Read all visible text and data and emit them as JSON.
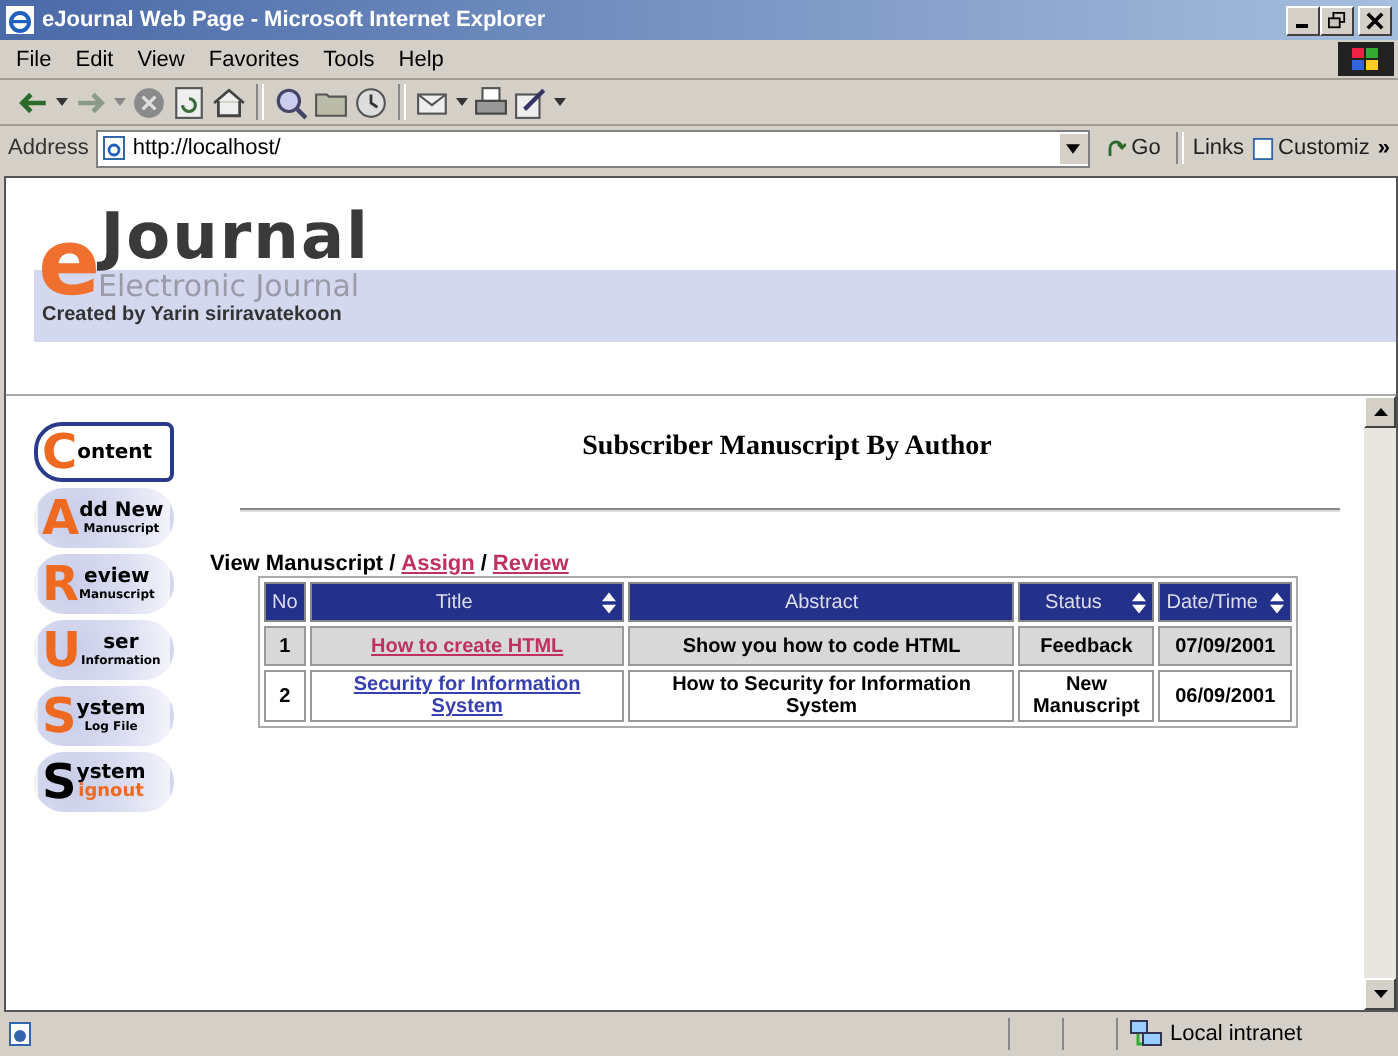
{
  "window": {
    "title": "eJournal Web Page - Microsoft Internet Explorer"
  },
  "menu": [
    "File",
    "Edit",
    "View",
    "Favorites",
    "Tools",
    "Help"
  ],
  "address_bar": {
    "label": "Address",
    "value": "http://localhost/",
    "go": "Go",
    "links": "Links",
    "link_item": "Customiz",
    "more": "»"
  },
  "logo": {
    "initial": "e",
    "word": "Journal",
    "subtitle": "Electronic Journal",
    "credit": "Created by Yarin siriravatekoon"
  },
  "nav": [
    {
      "initial": "C",
      "rest": "ontent",
      "selected": true,
      "kind": "plain"
    },
    {
      "initial": "A",
      "rest": "dd New",
      "sub": "Manuscript",
      "selected": false,
      "kind": "plain"
    },
    {
      "initial": "R",
      "rest": "eview",
      "sub": "Manuscript",
      "selected": false,
      "kind": "plain"
    },
    {
      "initial": "U",
      "rest": "ser",
      "sub": "Information",
      "selected": false,
      "kind": "plain"
    },
    {
      "initial": "S",
      "rest": "ystem",
      "sub": "Log File",
      "selected": false,
      "kind": "plain"
    },
    {
      "initial": "S",
      "rest": "ystem",
      "sub": "ignout",
      "selected": false,
      "kind": "inverse"
    }
  ],
  "heading": "Subscriber Manuscript By Author",
  "view_links": [
    {
      "label": "View Manuscript",
      "kind": "current"
    },
    {
      "label": "/",
      "kind": "separator"
    },
    {
      "label": "Assign",
      "kind": "link"
    },
    {
      "label": "/",
      "kind": "separator"
    },
    {
      "label": "Review",
      "kind": "link"
    }
  ],
  "table": {
    "columns": [
      {
        "label": "No",
        "sortable": false
      },
      {
        "label": "Title",
        "sortable": true
      },
      {
        "label": "Abstract",
        "sortable": false
      },
      {
        "label": "Status",
        "sortable": true
      },
      {
        "label": "Date/Time",
        "sortable": true
      }
    ],
    "rows": [
      {
        "no": "1",
        "title": "How to create HTML",
        "visited": true,
        "abstract": "Show you how to code HTML",
        "status": "Feedback",
        "date": "07/09/2001"
      },
      {
        "no": "2",
        "title": "Security for Information System",
        "visited": false,
        "abstract": "How to Security for Information System",
        "status": "New Manuscript",
        "date": "06/09/2001"
      }
    ]
  },
  "status_bar": {
    "zone": "Local intranet"
  }
}
